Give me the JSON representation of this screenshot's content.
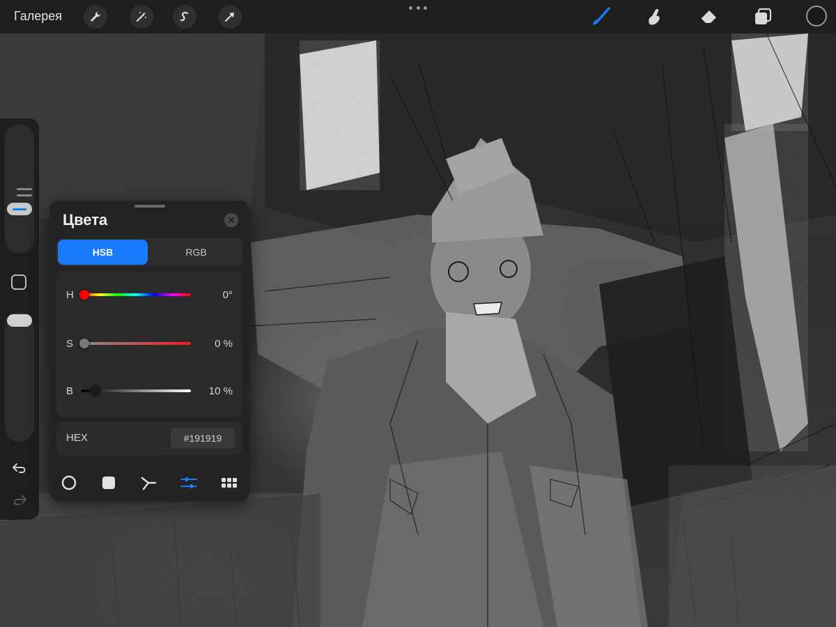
{
  "topbar": {
    "gallery_label": "Галерея",
    "left_tools": [
      "wrench-icon",
      "magic-wand-icon",
      "selection-s-icon",
      "transform-arrow-icon"
    ],
    "right_tools": [
      "brush-icon",
      "smudge-icon",
      "eraser-icon",
      "layers-icon"
    ],
    "current_color": "#191919",
    "accent": "#1a7bff"
  },
  "sidebar": {
    "brush_size_level": 0.23,
    "opacity_level": 0.0
  },
  "colors_panel": {
    "title": "Цвета",
    "modes": [
      {
        "label": "HSB",
        "active": true
      },
      {
        "label": "RGB",
        "active": false
      }
    ],
    "sliders": [
      {
        "label": "H",
        "value": "0°",
        "fraction": 0.0
      },
      {
        "label": "S",
        "value": "0 %",
        "fraction": 0.0
      },
      {
        "label": "B",
        "value": "10 %",
        "fraction": 0.1
      }
    ],
    "hex_label": "HEX",
    "hex_value": "#191919",
    "bottom_tabs": [
      "disc-icon",
      "square-icon",
      "harmony-icon",
      "value-sliders-icon",
      "palette-grid-icon"
    ],
    "active_tab": 3
  }
}
